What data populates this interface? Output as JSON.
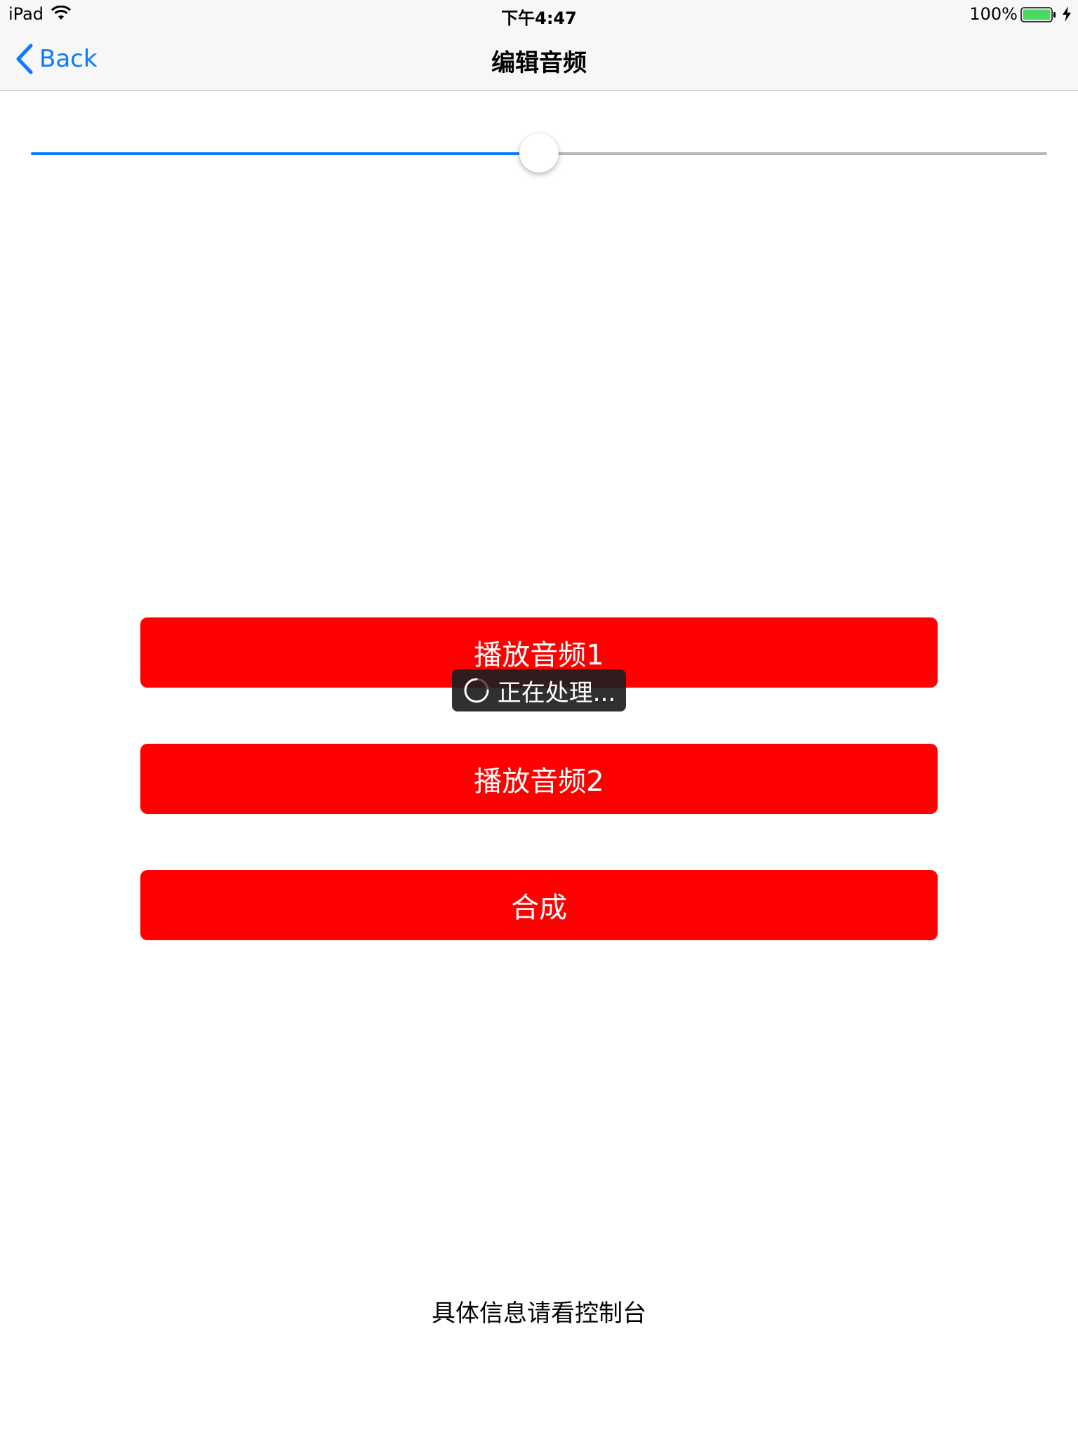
{
  "status_bar": {
    "device": "iPad",
    "time": "下午4:47",
    "battery_percent": "100%",
    "wifi_icon": "wifi-icon",
    "battery_icon": "battery-full-icon",
    "charging_icon": "charging-bolt-icon",
    "battery_color": "#4cd964"
  },
  "nav": {
    "back_label": "Back",
    "back_icon": "chevron-left-icon",
    "title": "编辑音频",
    "tint_color": "#0a7aff"
  },
  "slider": {
    "value_fraction": 0.5,
    "min_track_color": "#0a7aff",
    "max_track_color": "#b6b6b6"
  },
  "buttons": {
    "play_audio_1": "播放音频1",
    "play_audio_2": "播放音频2",
    "merge": "合成",
    "color": "#ff0000"
  },
  "hud": {
    "text": "正在处理...",
    "icon": "spinner-icon"
  },
  "footer": {
    "text": "具体信息请看控制台"
  }
}
